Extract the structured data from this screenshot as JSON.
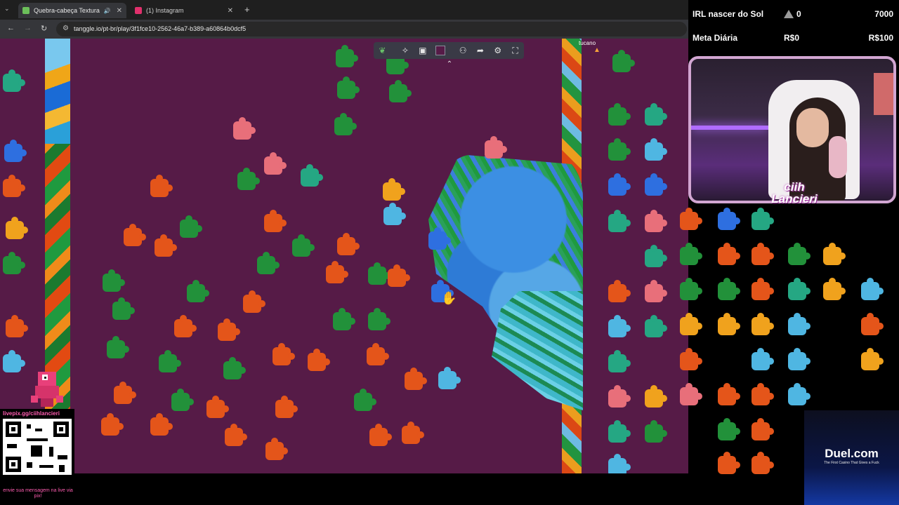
{
  "browser": {
    "tabs": [
      {
        "label": "Quebra-cabeça Textura",
        "active": true,
        "favicon_color": "#6cbf5a"
      },
      {
        "label": "(1) Instagram",
        "active": false,
        "favicon_color": "#e1306c"
      }
    ],
    "url": "tanggle.io/pt-br/play/3f1fce10-2562-46a7-b389-a60864b0dcf5"
  },
  "puzzle": {
    "board_color": "#561b47",
    "toolbar_icons": [
      "tanggle-logo-icon",
      "puzzle-piece-icon",
      "image-icon",
      "background-color-swatch",
      "users-icon",
      "share-icon",
      "settings-icon",
      "fullscreen-icon"
    ],
    "other_user_label": "tucano"
  },
  "overlay": {
    "goals": [
      {
        "name": "IRL nascer do Sol",
        "current": "0",
        "target": "7000"
      },
      {
        "name": "Meta Diária",
        "current": "R$0",
        "target": "R$100"
      }
    ],
    "streamer_name_line1": "ciih",
    "streamer_name_line2": "Lancieri",
    "livepix_url": "livepix.gg/ciihlancieri",
    "livepix_note": "envie sua mensagem na live via pix!",
    "sponsor": {
      "name": "Duel.com",
      "tagline": "The First Casino That Gives a Fuck"
    }
  }
}
